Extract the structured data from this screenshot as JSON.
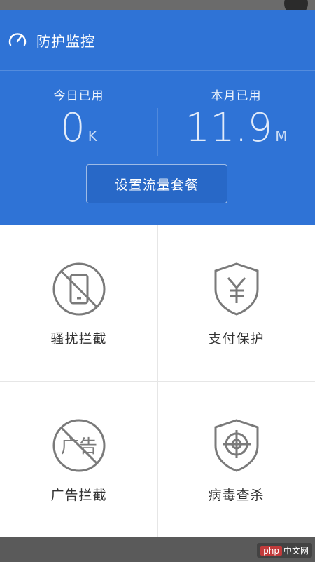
{
  "header": {
    "title": "防护监控",
    "today": {
      "label": "今日已用",
      "value": "0",
      "unit": "K"
    },
    "month": {
      "label": "本月已用",
      "value": "11.9",
      "unit": "M"
    },
    "plan_button": "设置流量套餐"
  },
  "features": [
    {
      "label": "骚扰拦截",
      "icon": "block-phone-icon"
    },
    {
      "label": "支付保护",
      "icon": "yen-shield-icon"
    },
    {
      "label": "广告拦截",
      "icon": "block-ad-icon"
    },
    {
      "label": "病毒查杀",
      "icon": "target-shield-icon"
    }
  ],
  "watermark": {
    "brand": "php",
    "text": "中文网"
  },
  "colors": {
    "primary": "#2f73d6",
    "icon_gray": "#7a7a7a"
  }
}
